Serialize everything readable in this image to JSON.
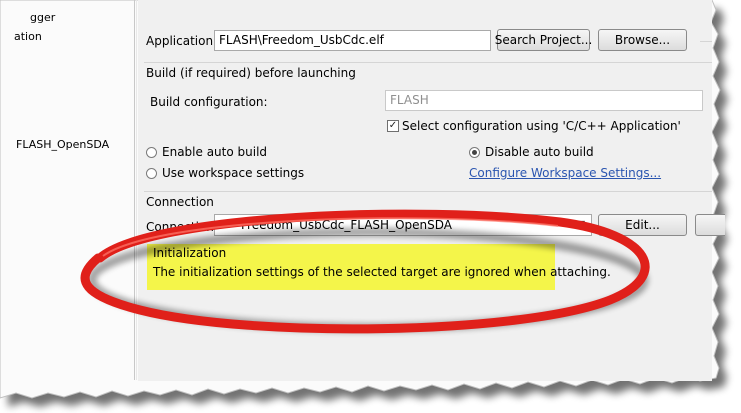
{
  "left_panel": {
    "items": [
      "gger",
      "ation",
      "FLASH_OpenSDA"
    ]
  },
  "application": {
    "label": "Application:",
    "value": "FLASH\\Freedom_UsbCdc.elf",
    "search_button": "Search Project...",
    "browse_button": "Browse..."
  },
  "build": {
    "group_title": "Build (if required) before launching",
    "config_label": "Build configuration:",
    "config_value": "FLASH",
    "select_config_checkbox": "Select configuration using 'C/C++ Application'",
    "enable_auto_build": "Enable auto build",
    "disable_auto_build": "Disable auto build",
    "use_workspace_settings": "Use workspace settings",
    "configure_link": "Configure Workspace Settings..."
  },
  "connection": {
    "group_title": "Connection",
    "label": "Connection:",
    "value": "Freedom_UsbCdc_FLASH_OpenSDA",
    "edit_button": "Edit..."
  },
  "initialization": {
    "title": "Initialization",
    "message": "The initialization settings of the selected target are ignored when attaching."
  },
  "colors": {
    "highlight": "#f4f54a",
    "annotation_ellipse": "#e0201a",
    "link": "#2a55b0"
  }
}
